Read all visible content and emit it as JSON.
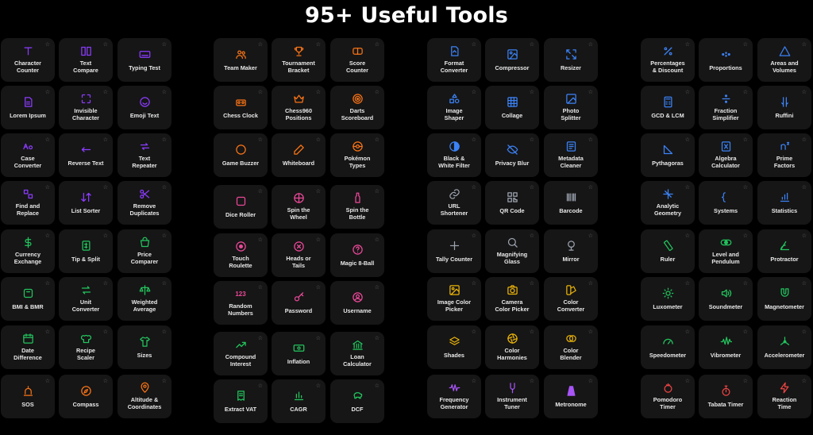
{
  "header": {
    "title": "95+ Useful Tools"
  },
  "favorite_glyph": "☆",
  "groups": [
    {
      "color": "#8b3cff",
      "tiles": [
        {
          "label": "Character\nCounter",
          "icon": "text-icon"
        },
        {
          "label": "Text\nCompare",
          "icon": "compare-icon"
        },
        {
          "label": "Typing Test",
          "icon": "keyboard-icon"
        },
        {
          "label": "Lorem Ipsum",
          "icon": "document-icon"
        },
        {
          "label": "Invisible\nCharacter",
          "icon": "invisible-icon"
        },
        {
          "label": "Emoji Text",
          "icon": "emoji-icon"
        },
        {
          "label": "Case\nConverter",
          "icon": "case-icon"
        },
        {
          "label": "Reverse Text",
          "icon": "reverse-icon"
        },
        {
          "label": "Text\nRepeater",
          "icon": "repeat-icon"
        },
        {
          "label": "Find and\nReplace",
          "icon": "find-replace-icon"
        },
        {
          "label": "List Sorter",
          "icon": "sort-icon"
        },
        {
          "label": "Remove\nDuplicates",
          "icon": "scissors-icon"
        }
      ]
    },
    {
      "color": "#22c55e",
      "tiles": [
        {
          "label": "Currency\nExchange",
          "icon": "dollar-icon"
        },
        {
          "label": "Tip & Split",
          "icon": "tip-icon"
        },
        {
          "label": "Price\nComparer",
          "icon": "price-icon"
        },
        {
          "label": "BMI & BMR",
          "icon": "scale-icon"
        },
        {
          "label": "Unit\nConverter",
          "icon": "arrows-icon"
        },
        {
          "label": "Weighted\nAverage",
          "icon": "balance-icon"
        },
        {
          "label": "Date\nDifference",
          "icon": "calendar-icon"
        },
        {
          "label": "Recipe\nScaler",
          "icon": "chef-icon"
        },
        {
          "label": "Sizes",
          "icon": "shirt-icon"
        }
      ]
    },
    {
      "color": "#f97316",
      "tiles": [
        {
          "label": "SOS",
          "icon": "siren-icon"
        },
        {
          "label": "Compass",
          "icon": "compass-icon"
        },
        {
          "label": "Altitude &\nCoordinates",
          "icon": "pin-icon"
        },
        {
          "label": "Team Maker",
          "icon": "team-icon"
        },
        {
          "label": "Tournament\nBracket",
          "icon": "trophy-icon"
        },
        {
          "label": "Score\nCounter",
          "icon": "score-icon"
        },
        {
          "label": "Chess Clock",
          "icon": "chess-clock-icon"
        },
        {
          "label": "Chess960\nPositions",
          "icon": "crown-icon"
        },
        {
          "label": "Darts\nScoreboard",
          "icon": "target-icon"
        },
        {
          "label": "Game Buzzer",
          "icon": "buzzer-icon"
        },
        {
          "label": "Whiteboard",
          "icon": "pencil-icon"
        },
        {
          "label": "Pokémon\nTypes",
          "icon": "pokeball-icon"
        }
      ]
    },
    {
      "color": "#ec4899",
      "tiles": [
        {
          "label": "Dice Roller",
          "icon": "dice-icon"
        },
        {
          "label": "Spin the\nWheel",
          "icon": "wheel-icon"
        },
        {
          "label": "Spin the\nBottle",
          "icon": "bottle-icon"
        },
        {
          "label": "Touch\nRoulette",
          "icon": "roulette-icon"
        },
        {
          "label": "Heads or\nTails",
          "icon": "coin-icon"
        },
        {
          "label": "Magic 8-Ball",
          "icon": "question-icon"
        },
        {
          "label": "Random\nNumbers",
          "icon": "numbers-icon",
          "icon_text": "123"
        },
        {
          "label": "Password",
          "icon": "key-icon"
        },
        {
          "label": "Username",
          "icon": "user-icon"
        }
      ]
    },
    {
      "color": "#22c55e",
      "tiles": [
        {
          "label": "Compound\nInterest",
          "icon": "trend-icon"
        },
        {
          "label": "Inflation",
          "icon": "cash-icon"
        },
        {
          "label": "Loan\nCalculator",
          "icon": "bank-icon"
        },
        {
          "label": "Extract VAT",
          "icon": "receipt-icon"
        },
        {
          "label": "CAGR",
          "icon": "bar-chart-icon"
        },
        {
          "label": "DCF",
          "icon": "piggy-icon"
        }
      ]
    },
    {
      "color": "#3b82f6",
      "tiles": [
        {
          "label": "Format\nConverter",
          "icon": "file-convert-icon"
        },
        {
          "label": "Compressor",
          "icon": "compress-icon"
        },
        {
          "label": "Resizer",
          "icon": "resize-icon"
        },
        {
          "label": "Image\nShaper",
          "icon": "shapes-icon"
        },
        {
          "label": "Collage",
          "icon": "grid-icon"
        },
        {
          "label": "Photo\nSplitter",
          "icon": "photo-icon"
        },
        {
          "label": "Black &\nWhite Filter",
          "icon": "contrast-icon"
        },
        {
          "label": "Privacy Blur",
          "icon": "eye-off-icon"
        },
        {
          "label": "Metadata\nCleaner",
          "icon": "metadata-icon"
        }
      ]
    },
    {
      "color": "#9ca3af",
      "tiles": [
        {
          "label": "URL\nShortener",
          "icon": "link-icon"
        },
        {
          "label": "QR Code",
          "icon": "qr-icon"
        },
        {
          "label": "Barcode",
          "icon": "barcode-icon"
        },
        {
          "label": "Tally Counter",
          "icon": "plus-icon"
        },
        {
          "label": "Magnifying\nGlass",
          "icon": "magnifier-icon"
        },
        {
          "label": "Mirror",
          "icon": "mirror-icon"
        }
      ]
    },
    {
      "color": "#eab308",
      "tiles": [
        {
          "label": "Image Color\nPicker",
          "icon": "image-picker-icon"
        },
        {
          "label": "Camera\nColor Picker",
          "icon": "camera-icon"
        },
        {
          "label": "Color\nConverter",
          "icon": "swatch-icon"
        },
        {
          "label": "Shades",
          "icon": "layers-icon"
        },
        {
          "label": "Color\nHarmonies",
          "icon": "aperture-icon"
        },
        {
          "label": "Color\nBlender",
          "icon": "blend-icon"
        }
      ]
    },
    {
      "color": "#a855f7",
      "tiles": [
        {
          "label": "Frequency\nGenerator",
          "icon": "wave-icon"
        },
        {
          "label": "Instrument\nTuner",
          "icon": "tuning-fork-icon"
        },
        {
          "label": "Metronome",
          "icon": "metronome-icon"
        }
      ]
    },
    {
      "color": "#3b82f6",
      "tiles": [
        {
          "label": "Percentages\n& Discount",
          "icon": "percent-icon"
        },
        {
          "label": "Proportions",
          "icon": "ratio-icon"
        },
        {
          "label": "Areas and\nVolumes",
          "icon": "triangle-icon"
        },
        {
          "label": "GCD & LCM",
          "icon": "calculator-icon"
        },
        {
          "label": "Fraction\nSimplifier",
          "icon": "divide-icon"
        },
        {
          "label": "Ruffini",
          "icon": "ruffini-icon"
        },
        {
          "label": "Pythagoras",
          "icon": "right-triangle-icon"
        },
        {
          "label": "Algebra\nCalculator",
          "icon": "algebra-icon"
        },
        {
          "label": "Prime\nFactors",
          "icon": "superscript-icon"
        },
        {
          "label": "Analytic\nGeometry",
          "icon": "axis-icon"
        },
        {
          "label": "Systems",
          "icon": "brace-icon"
        },
        {
          "label": "Statistics",
          "icon": "stats-icon"
        }
      ]
    },
    {
      "color": "#22c55e",
      "tiles": [
        {
          "label": "Ruler",
          "icon": "ruler-icon"
        },
        {
          "label": "Level and\nPendulum",
          "icon": "level-icon"
        },
        {
          "label": "Protractor",
          "icon": "protractor-icon"
        },
        {
          "label": "Luxometer",
          "icon": "sun-icon"
        },
        {
          "label": "Soundmeter",
          "icon": "speaker-icon"
        },
        {
          "label": "Magnetometer",
          "icon": "magnet-icon"
        },
        {
          "label": "Speedometer",
          "icon": "gauge-icon"
        },
        {
          "label": "Vibrometer",
          "icon": "vibration-icon"
        },
        {
          "label": "Accelerometer",
          "icon": "accel-icon"
        }
      ]
    },
    {
      "color": "#ef4444",
      "tiles": [
        {
          "label": "Pomodoro\nTimer",
          "icon": "tomato-icon"
        },
        {
          "label": "Tabata Timer",
          "icon": "stopwatch-icon"
        },
        {
          "label": "Reaction\nTime",
          "icon": "bolt-icon"
        }
      ]
    }
  ]
}
